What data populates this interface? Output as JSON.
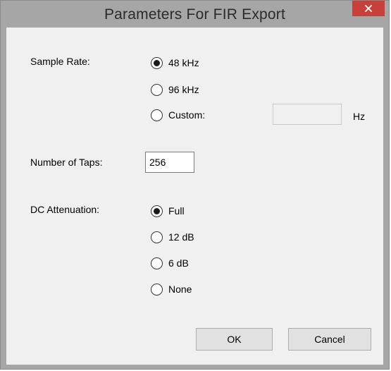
{
  "window": {
    "title": "Parameters For FIR Export",
    "close_label": "✕"
  },
  "sample_rate": {
    "label": "Sample Rate:",
    "options": [
      {
        "label": "48 kHz",
        "selected": true
      },
      {
        "label": "96 kHz",
        "selected": false
      },
      {
        "label": "Custom:",
        "selected": false
      }
    ],
    "custom_value": "",
    "unit": "Hz"
  },
  "taps": {
    "label": "Number of Taps:",
    "value": "256"
  },
  "dc_attenuation": {
    "label": "DC Attenuation:",
    "options": [
      {
        "label": "Full",
        "selected": true
      },
      {
        "label": "12 dB",
        "selected": false
      },
      {
        "label": "6 dB",
        "selected": false
      },
      {
        "label": "None",
        "selected": false
      }
    ]
  },
  "buttons": {
    "ok": "OK",
    "cancel": "Cancel"
  },
  "colors": {
    "close_bg": "#c7413a",
    "frame": "#a6a6a6",
    "client_bg": "#f0f0f0"
  }
}
